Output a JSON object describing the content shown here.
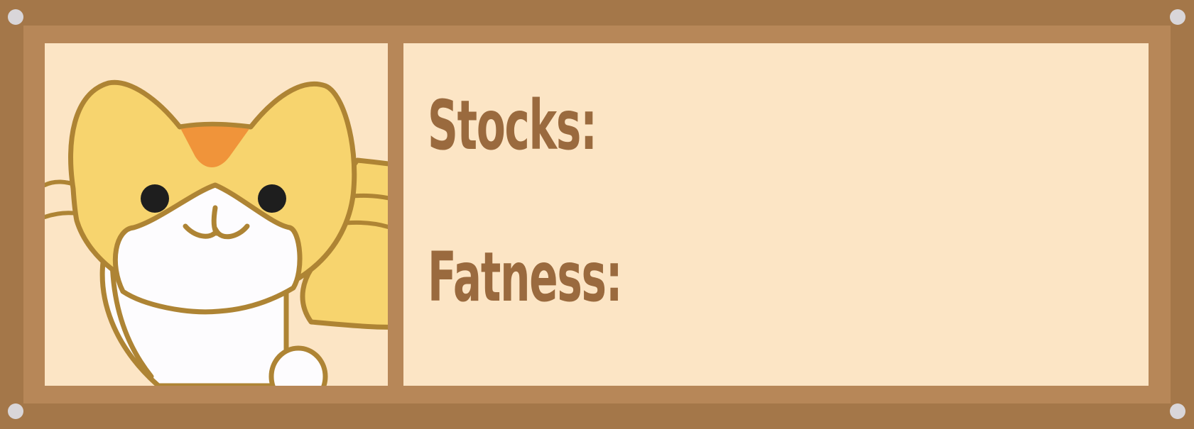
{
  "stats": {
    "stocks_label": "Stocks:",
    "stocks_value": "",
    "fatness_label": "Fatness:",
    "fatness_value": ""
  },
  "portrait": {
    "character": "yellow cat",
    "icon": "cat-portrait-icon"
  },
  "colors": {
    "frame_outer": "#a47749",
    "frame_inner": "#b78758",
    "panel_background": "#fce5c5",
    "label_text": "#9a6a3e",
    "cat_fur": "#f7d46e",
    "cat_outline": "#ae8434",
    "cat_belly": "#fdfcfe",
    "cat_nose": "#f0943a",
    "cat_eye": "#1e1e1e",
    "screw": "#d9d6d9"
  }
}
